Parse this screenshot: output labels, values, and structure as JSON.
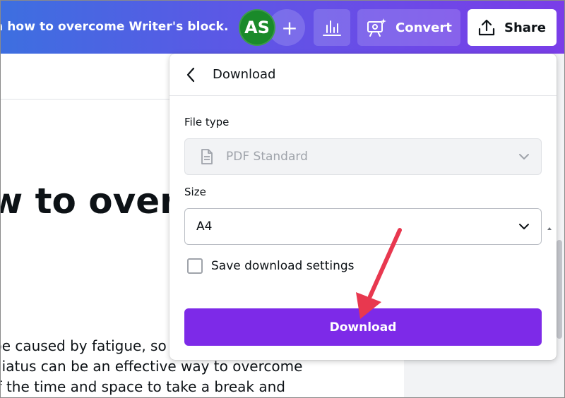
{
  "topbar": {
    "doc_title": "n how to overcome Writer's block.",
    "avatar_initials": "AS",
    "add_label": "+",
    "convert_label": "Convert",
    "share_label": "Share",
    "icons": [
      "plus-icon",
      "bar-chart-icon",
      "presentation-sparkle-icon",
      "upload-icon"
    ]
  },
  "document": {
    "heading": "w to over",
    "body_lines": [
      " be caused by fatigue, so",
      "hiatus can be an effective way to overcome",
      "lf the time and space to take a break and"
    ]
  },
  "panel": {
    "title": "Download",
    "file_type_label": "File type",
    "file_type_value": "PDF Standard",
    "size_label": "Size",
    "size_value": "A4",
    "save_settings_label": "Save download settings",
    "save_settings_checked": false,
    "download_button": "Download"
  },
  "colors": {
    "brand_purple": "#7d2ae8",
    "avatar_green": "#1a8a2a",
    "annotation_arrow": "#e8384f",
    "topbar_gradient_start": "#3d6fe0",
    "topbar_gradient_end": "#7a3de8"
  }
}
